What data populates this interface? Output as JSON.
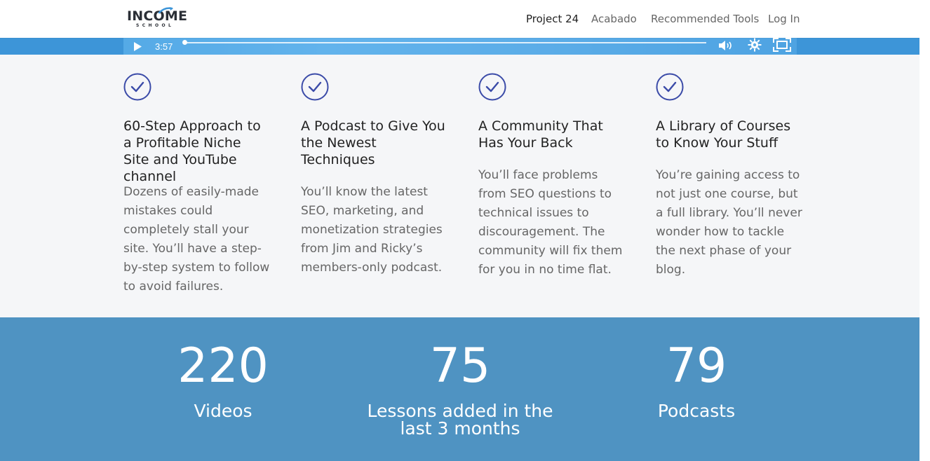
{
  "header": {
    "logo_main": "INCOME",
    "logo_sub": "SCHOOL",
    "nav": [
      {
        "label": "Project 24",
        "active": true
      },
      {
        "label": "Acabado",
        "active": false
      },
      {
        "label": "Recommended Tools",
        "active": false
      },
      {
        "label": "Log In",
        "active": false
      }
    ]
  },
  "player": {
    "time": "3:57",
    "progress": 0,
    "icons": [
      "play-icon",
      "volume-icon",
      "gear-icon",
      "fullscreen-icon"
    ]
  },
  "features": [
    {
      "icon": "check-circle-icon",
      "title": "60-Step Approach to a Profitable Niche Site and YouTube channel",
      "desc": "Dozens of easily-made mistakes could completely stall your site.  You’ll have a step-by-step system to follow to avoid failures."
    },
    {
      "icon": "check-circle-icon",
      "title": "A Podcast to Give You the Newest Techniques",
      "desc": "You’ll know the latest SEO, marketing, and monetization strategies from Jim and Ricky’s members-only podcast."
    },
    {
      "icon": "check-circle-icon",
      "title": "A Community That Has Your Back",
      "desc": "You’ll face problems from SEO questions to technical issues to discouragement.  The community will fix them for you in no time flat."
    },
    {
      "icon": "check-circle-icon",
      "title": "A Library of Courses to Know Your Stuff",
      "desc": "You’re gaining access to not just one course, but a full library.  You’ll never wonder how to tackle the next phase of your blog."
    }
  ],
  "stats": [
    {
      "number": "220",
      "label": "Videos"
    },
    {
      "number": "75",
      "label": "Lessons added in the last 3 months"
    },
    {
      "number": "79",
      "label": "Podcasts"
    }
  ],
  "colors": {
    "accent": "#3d95d8",
    "check": "#3b4ba8",
    "stats_bg": "#4f93c2",
    "features_bg": "#f5f6f8"
  }
}
